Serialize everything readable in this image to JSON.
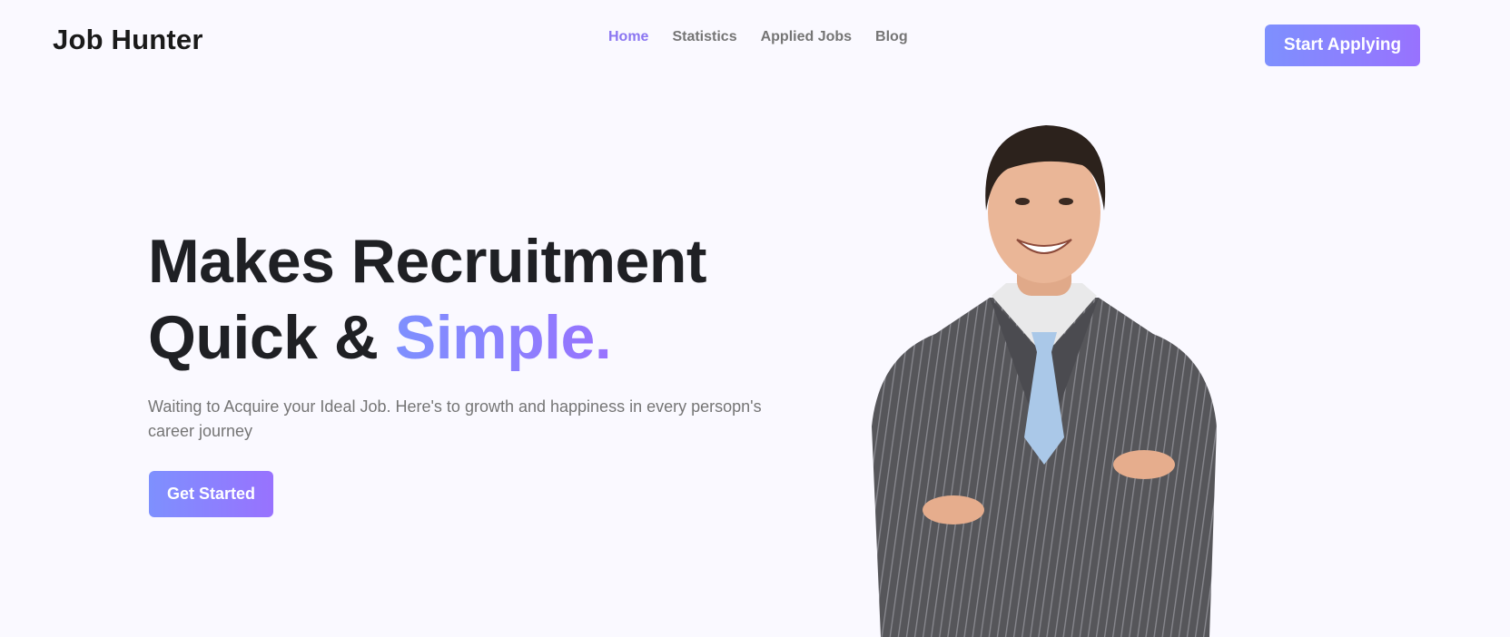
{
  "header": {
    "logo": "Job Hunter",
    "nav": [
      {
        "label": "Home",
        "active": true
      },
      {
        "label": "Statistics",
        "active": false
      },
      {
        "label": "Applied Jobs",
        "active": false
      },
      {
        "label": "Blog",
        "active": false
      }
    ],
    "cta_label": "Start Applying"
  },
  "hero": {
    "line1": "Makes Recruitment",
    "line2_prefix": "Quick & ",
    "line2_accent": "Simple.",
    "subtitle": "Waiting to Acquire your Ideal Job. Here's to growth and happiness in every persopn's career journey",
    "cta_label": "Get Started"
  },
  "colors": {
    "accent_start": "#7e90fe",
    "accent_end": "#9872fe",
    "background": "#faf9ff",
    "nav_active": "#8b76f1"
  },
  "icons": {
    "hero_image": "smiling-businessman-photo"
  }
}
